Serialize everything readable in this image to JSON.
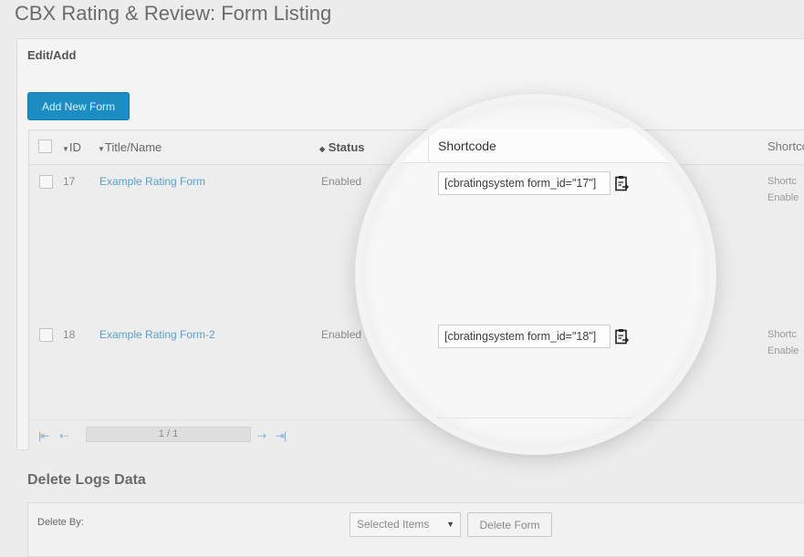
{
  "page": {
    "title": "CBX Rating & Review: Form Listing"
  },
  "panel": {
    "heading": "Edit/Add",
    "add_button": "Add New Form"
  },
  "table": {
    "headers": {
      "id": "ID",
      "title": "Title/Name",
      "status": "Status",
      "shortcode": "Shortcode",
      "extra": "Shortco"
    },
    "rows": [
      {
        "id": "17",
        "title": "Example Rating Form",
        "status": "Enabled",
        "shortcode": "[cbratingsystem form_id=\"17\"]",
        "extra1": "Shortc",
        "extra2": "Enable"
      },
      {
        "id": "18",
        "title": "Example Rating Form-2",
        "status": "Enabled",
        "shortcode": "[cbratingsystem form_id=\"18\"]",
        "extra1": "Shortc",
        "extra2": "Enable"
      }
    ],
    "pagination": {
      "page": "1 / 1"
    }
  },
  "delete_logs": {
    "title": "Delete Logs Data",
    "label": "Delete By:",
    "select_value": "Selected Items",
    "button": "Delete Form"
  }
}
